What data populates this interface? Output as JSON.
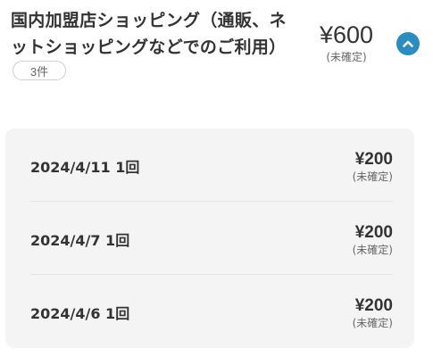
{
  "header": {
    "title": "国内加盟店ショッピング（通販、ネットショッピングなどでのご利用）",
    "count": "3件",
    "amount": "¥600",
    "status": "(未確定)",
    "toggle_icon": "chevron-up-icon"
  },
  "colors": {
    "accent": "#2a8cbf",
    "card_bg": "#f4f4f4",
    "text": "#333333"
  },
  "details": [
    {
      "date": "2024/4/11 1回",
      "amount": "¥200",
      "status": "(未確定)"
    },
    {
      "date": "2024/4/7 1回",
      "amount": "¥200",
      "status": "(未確定)"
    },
    {
      "date": "2024/4/6 1回",
      "amount": "¥200",
      "status": "(未確定)"
    }
  ]
}
